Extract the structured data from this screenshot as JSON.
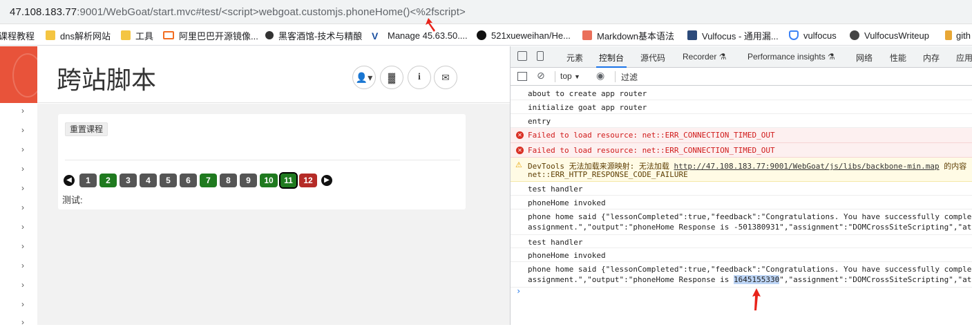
{
  "browser": {
    "url_host": "47.108.183.77",
    "url_rest": ":9001/WebGoat/start.mvc#test/<script>webgoat.customjs.phoneHome()<%2fscript>"
  },
  "bookmarks": [
    {
      "label": "课程教程",
      "icon": "none"
    },
    {
      "label": "dns解析网站",
      "icon": "folder-icon"
    },
    {
      "label": "工具",
      "icon": "folder-icon"
    },
    {
      "label": "阿里巴巴开源镜像...",
      "icon": "alibaba-icon"
    },
    {
      "label": "黑客酒馆-技术与精酿",
      "icon": "spider-icon"
    },
    {
      "label": "Manage 45.63.50....",
      "icon": "v-icon"
    },
    {
      "label": "521xueweihan/He...",
      "icon": "github-icon"
    },
    {
      "label": "Markdown基本语法",
      "icon": "jianshu-icon"
    },
    {
      "label": "Vulfocus - 通用漏...",
      "icon": "cube-icon"
    },
    {
      "label": "vulfocus",
      "icon": "shield-icon"
    },
    {
      "label": "VulfocusWriteup",
      "icon": "globe-icon"
    },
    {
      "label": "gith",
      "icon": "pen-icon"
    }
  ],
  "webgoat": {
    "title": "跨站脚本",
    "reset_label": "重置课程",
    "test_label": "测试:",
    "pages": [
      {
        "n": "1",
        "state": "gray"
      },
      {
        "n": "2",
        "state": "green"
      },
      {
        "n": "3",
        "state": "gray"
      },
      {
        "n": "4",
        "state": "gray"
      },
      {
        "n": "5",
        "state": "gray"
      },
      {
        "n": "6",
        "state": "gray"
      },
      {
        "n": "7",
        "state": "green"
      },
      {
        "n": "8",
        "state": "gray"
      },
      {
        "n": "9",
        "state": "gray"
      },
      {
        "n": "10",
        "state": "green"
      },
      {
        "n": "11",
        "state": "green-selected"
      },
      {
        "n": "12",
        "state": "red"
      }
    ],
    "header_buttons": [
      "user-icon",
      "chart-icon",
      "info-icon",
      "mail-icon"
    ]
  },
  "devtools": {
    "tabs": [
      "元素",
      "控制台",
      "源代码",
      "Recorder ⚗",
      "Performance insights ⚗",
      "网络",
      "性能",
      "内存",
      "应用"
    ],
    "active_tab": "控制台",
    "context": "top",
    "filter_placeholder": "过滤",
    "logs": [
      {
        "type": "log",
        "text": "about to create app router"
      },
      {
        "type": "log",
        "text": "initialize goat app router"
      },
      {
        "type": "log",
        "text": "entry"
      },
      {
        "type": "error",
        "text": "Failed to load resource: net::ERR_CONNECTION_TIMED_OUT"
      },
      {
        "type": "error",
        "text": "Failed to load resource: net::ERR_CONNECTION_TIMED_OUT"
      },
      {
        "type": "warn",
        "pre": "DevTools 无法加载来源映射: 无法加载 ",
        "link": "http://47.108.183.77:9001/WebGoat/js/libs/backbone-min.map",
        "post": " 的内容",
        "line2": "net::ERR_HTTP_RESPONSE_CODE_FAILURE"
      },
      {
        "type": "log",
        "text": "test handler"
      },
      {
        "type": "log",
        "text": "phoneHome invoked"
      },
      {
        "type": "log",
        "line1": "phone home said {\"lessonCompleted\":true,\"feedback\":\"Congratulations. You have successfully complet",
        "line2": "assignment.\",\"output\":\"phoneHome Response is -501380931\",\"assignment\":\"DOMCrossSiteScripting\",\"att"
      },
      {
        "type": "log",
        "text": "test handler"
      },
      {
        "type": "log",
        "text": "phoneHome invoked"
      },
      {
        "type": "log",
        "line1": "phone home said {\"lessonCompleted\":true,\"feedback\":\"Congratulations. You have successfully complet",
        "line2_pre": "assignment.\",\"output\":\"phoneHome Response is ",
        "highlight": "1645155330",
        "line2_post": "\",\"assignment\":\"DOMCrossSiteScripting\",\"att"
      }
    ]
  },
  "colors": {
    "annotation": "#e8231a",
    "green": "#1f7a1f",
    "red": "#b52b27",
    "brand": "#e8533a"
  }
}
